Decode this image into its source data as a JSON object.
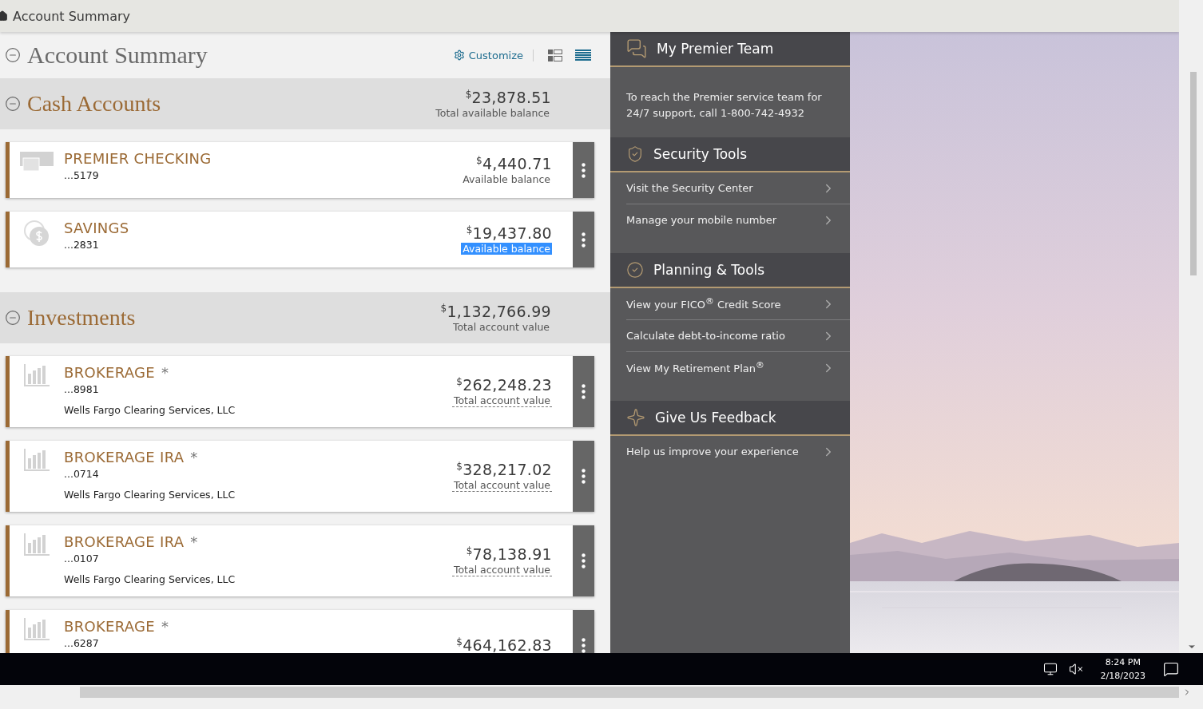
{
  "breadcrumb": "Account Summary",
  "page_title": "Account Summary",
  "page_expanded": true,
  "customize": "Customize",
  "views": [
    {
      "kind": "tiles",
      "selected": false
    },
    {
      "kind": "list",
      "selected": true
    }
  ],
  "sections": [
    {
      "title": "Cash Accounts",
      "expanded": true,
      "currency": "$",
      "total": "23,878.51",
      "total_label": "Total available balance",
      "accounts": [
        {
          "kind": "checking",
          "name": "PREMIER CHECKING",
          "number": "...5179",
          "currency": "$",
          "amount": "4,440.71",
          "label": "Available balance",
          "label_highlighted": false,
          "label_underlined": false
        },
        {
          "kind": "savings",
          "name": "SAVINGS",
          "number": "...2831",
          "currency": "$",
          "amount": "19,437.80",
          "label": "Available balance",
          "label_highlighted": true,
          "label_underlined": false
        }
      ]
    },
    {
      "title": "Investments",
      "expanded": true,
      "currency": "$",
      "total": "1,132,766.99",
      "total_label": "Total account value",
      "accounts": [
        {
          "kind": "brokerage",
          "name": "BROKERAGE",
          "marker": "*",
          "number": "...8981",
          "firm": "Wells Fargo Clearing Services, LLC",
          "currency": "$",
          "amount": "262,248.23",
          "label": "Total account value",
          "label_highlighted": false,
          "label_underlined": true
        },
        {
          "kind": "brokerage",
          "name": "BROKERAGE IRA",
          "marker": "*",
          "number": "...0714",
          "firm": "Wells Fargo Clearing Services, LLC",
          "currency": "$",
          "amount": "328,217.02",
          "label": "Total account value",
          "label_highlighted": false,
          "label_underlined": true
        },
        {
          "kind": "brokerage",
          "name": "BROKERAGE IRA",
          "marker": "*",
          "number": "...0107",
          "firm": "Wells Fargo Clearing Services, LLC",
          "currency": "$",
          "amount": "78,138.91",
          "label": "Total account value",
          "label_highlighted": false,
          "label_underlined": true
        },
        {
          "kind": "brokerage",
          "name": "BROKERAGE",
          "marker": "*",
          "number": "...6287",
          "currency": "$",
          "amount": "464,162.83"
        }
      ]
    }
  ],
  "side_panel": [
    {
      "kind": "team",
      "title": "My Premier Team",
      "text": "To reach the Premier service team for 24/7 support, call 1-800-742-4932"
    },
    {
      "kind": "security",
      "title": "Security Tools",
      "links": [
        "Visit the Security Center",
        "Manage your mobile number"
      ]
    },
    {
      "kind": "planning",
      "title": "Planning & Tools",
      "links": [
        "View your FICO$^{®}$ Credit Score",
        "Calculate debt-to-income ratio",
        "View My Retirement Plan$^{®}$"
      ]
    },
    {
      "kind": "feedback",
      "title": "Give Us Feedback",
      "links": [
        "Help us improve your experience"
      ]
    }
  ],
  "taskbar": {
    "time": "8:24 PM",
    "date": "2/18/2023",
    "sound_muted": true
  }
}
